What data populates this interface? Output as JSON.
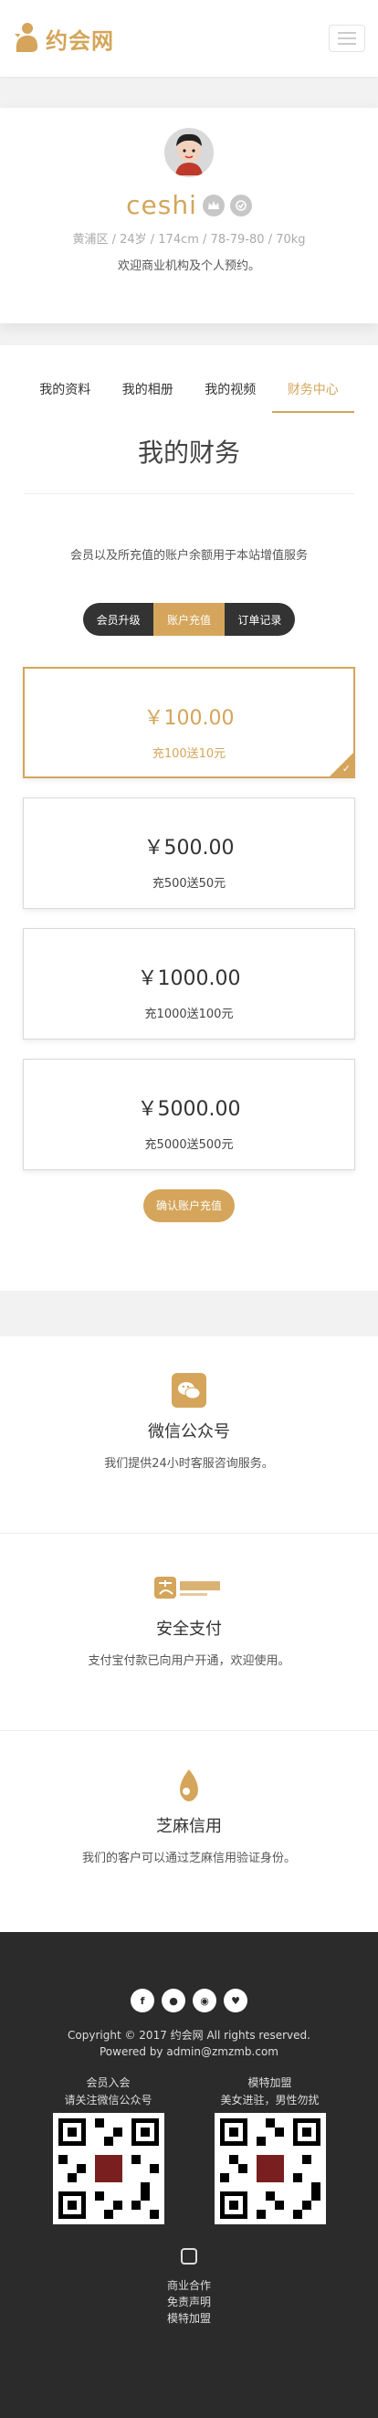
{
  "header": {
    "logo_text": "约会网"
  },
  "profile": {
    "name": "ceshi",
    "stats": "黄浦区 / 24岁 / 174cm / 78-79-80 / 70kg",
    "bio": "欢迎商业机构及个人预约。"
  },
  "tabs": [
    {
      "label": "我的资料"
    },
    {
      "label": "我的相册"
    },
    {
      "label": "我的视频"
    },
    {
      "label": "财务中心"
    }
  ],
  "finance": {
    "title": "我的财务",
    "description": "会员以及所充值的账户余额用于本站增值服务",
    "segments": [
      {
        "label": "会员升级"
      },
      {
        "label": "账户充值"
      },
      {
        "label": "订单记录"
      }
    ],
    "cards": [
      {
        "amount": "￥100.00",
        "note": "充100送10元"
      },
      {
        "amount": "￥500.00",
        "note": "充500送50元"
      },
      {
        "amount": "￥1000.00",
        "note": "充1000送100元"
      },
      {
        "amount": "￥5000.00",
        "note": "充5000送500元"
      }
    ],
    "confirm_label": "确认账户充值"
  },
  "features": [
    {
      "title": "微信公众号",
      "desc": "我们提供24小时客服咨询服务。"
    },
    {
      "title": "安全支付",
      "desc": "支付宝付款已向用户开通，欢迎使用。"
    },
    {
      "title": "芝麻信用",
      "desc": "我们的客户可以通过芝麻信用验证身份。"
    }
  ],
  "footer": {
    "social": [
      "f",
      "●",
      "◉",
      "♥"
    ],
    "copyright": "Copyright © 2017 约会网 All rights reserved.",
    "powered": "Powered by admin@zmzmb.com",
    "qr_left": {
      "title": "会员入会",
      "sub": "请关注微信公众号"
    },
    "qr_right": {
      "title": "模特加盟",
      "sub": "美女进驻，男性勿扰"
    },
    "links": [
      "商业合作",
      "免责声明",
      "模特加盟"
    ]
  },
  "colors": {
    "accent": "#d4a55a",
    "footer_bg": "#2b2b2b"
  }
}
